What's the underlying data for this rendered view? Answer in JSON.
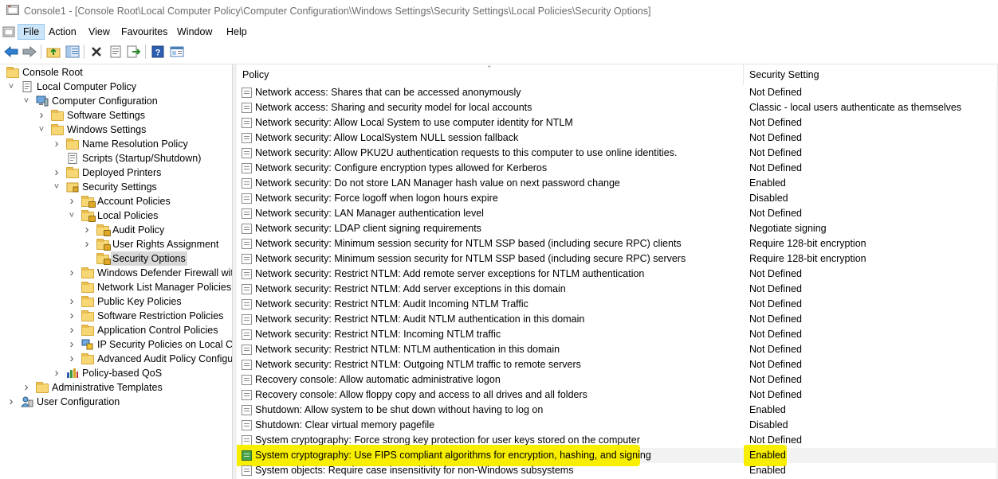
{
  "window": {
    "title": "Console1 - [Console Root\\Local Computer Policy\\Computer Configuration\\Windows Settings\\Security Settings\\Local Policies\\Security Options]"
  },
  "menu": {
    "items": [
      "File",
      "Action",
      "View",
      "Favourites",
      "Window",
      "Help"
    ],
    "active": "File"
  },
  "toolbar": {
    "buttons": [
      "back-icon",
      "forward-icon",
      "up-folder-icon",
      "show-hide-tree-icon",
      "delete-icon",
      "properties-icon",
      "export-list-icon",
      "help-icon",
      "extended-view-icon"
    ]
  },
  "tree": {
    "items": [
      {
        "label": "Console Root",
        "selected": false
      },
      {
        "label": "Local Computer Policy",
        "selected": false
      },
      {
        "label": "Computer Configuration",
        "selected": false
      },
      {
        "label": "Software Settings",
        "selected": false
      },
      {
        "label": "Windows Settings",
        "selected": false
      },
      {
        "label": "Name Resolution Policy",
        "selected": false
      },
      {
        "label": "Scripts (Startup/Shutdown)",
        "selected": false
      },
      {
        "label": "Deployed Printers",
        "selected": false
      },
      {
        "label": "Security Settings",
        "selected": false
      },
      {
        "label": "Account Policies",
        "selected": false
      },
      {
        "label": "Local Policies",
        "selected": false
      },
      {
        "label": "Audit Policy",
        "selected": false
      },
      {
        "label": "User Rights Assignment",
        "selected": false
      },
      {
        "label": "Security Options",
        "selected": true
      },
      {
        "label": "Windows Defender Firewall with",
        "selected": false
      },
      {
        "label": "Network List Manager Policies",
        "selected": false
      },
      {
        "label": "Public Key Policies",
        "selected": false
      },
      {
        "label": "Software Restriction Policies",
        "selected": false
      },
      {
        "label": "Application Control Policies",
        "selected": false
      },
      {
        "label": "IP Security Policies on Local Cor",
        "selected": false
      },
      {
        "label": "Advanced Audit Policy Configur",
        "selected": false
      },
      {
        "label": "Policy-based QoS",
        "selected": false
      },
      {
        "label": "Administrative Templates",
        "selected": false
      },
      {
        "label": "User Configuration",
        "selected": false
      }
    ]
  },
  "list": {
    "columns": {
      "policy": "Policy",
      "setting": "Security Setting"
    },
    "rows": [
      {
        "policy": "Network access: Shares that can be accessed anonymously",
        "setting": "Not Defined"
      },
      {
        "policy": "Network access: Sharing and security model for local accounts",
        "setting": "Classic - local users authenticate as themselves"
      },
      {
        "policy": "Network security: Allow Local System to use computer identity for NTLM",
        "setting": "Not Defined"
      },
      {
        "policy": "Network security: Allow LocalSystem NULL session fallback",
        "setting": "Not Defined"
      },
      {
        "policy": "Network security: Allow PKU2U authentication requests to this computer to use online identities.",
        "setting": "Not Defined"
      },
      {
        "policy": "Network security: Configure encryption types allowed for Kerberos",
        "setting": "Not Defined"
      },
      {
        "policy": "Network security: Do not store LAN Manager hash value on next password change",
        "setting": "Enabled"
      },
      {
        "policy": "Network security: Force logoff when logon hours expire",
        "setting": "Disabled"
      },
      {
        "policy": "Network security: LAN Manager authentication level",
        "setting": "Not Defined"
      },
      {
        "policy": "Network security: LDAP client signing requirements",
        "setting": "Negotiate signing"
      },
      {
        "policy": "Network security: Minimum session security for NTLM SSP based (including secure RPC) clients",
        "setting": "Require 128-bit encryption"
      },
      {
        "policy": "Network security: Minimum session security for NTLM SSP based (including secure RPC) servers",
        "setting": "Require 128-bit encryption"
      },
      {
        "policy": "Network security: Restrict NTLM: Add remote server exceptions for NTLM authentication",
        "setting": "Not Defined"
      },
      {
        "policy": "Network security: Restrict NTLM: Add server exceptions in this domain",
        "setting": "Not Defined"
      },
      {
        "policy": "Network security: Restrict NTLM: Audit Incoming NTLM Traffic",
        "setting": "Not Defined"
      },
      {
        "policy": "Network security: Restrict NTLM: Audit NTLM authentication in this domain",
        "setting": "Not Defined"
      },
      {
        "policy": "Network security: Restrict NTLM: Incoming NTLM traffic",
        "setting": "Not Defined"
      },
      {
        "policy": "Network security: Restrict NTLM: NTLM authentication in this domain",
        "setting": "Not Defined"
      },
      {
        "policy": "Network security: Restrict NTLM: Outgoing NTLM traffic to remote servers",
        "setting": "Not Defined"
      },
      {
        "policy": "Recovery console: Allow automatic administrative logon",
        "setting": "Not Defined"
      },
      {
        "policy": "Recovery console: Allow floppy copy and access to all drives and all folders",
        "setting": "Not Defined"
      },
      {
        "policy": "Shutdown: Allow system to be shut down without having to log on",
        "setting": "Enabled"
      },
      {
        "policy": "Shutdown: Clear virtual memory pagefile",
        "setting": "Disabled"
      },
      {
        "policy": "System cryptography: Force strong key protection for user keys stored on the computer",
        "setting": "Not Defined"
      },
      {
        "policy": "System cryptography: Use FIPS compliant algorithms for encryption, hashing, and signing",
        "setting": "Enabled",
        "highlighted": true
      },
      {
        "policy": "System objects: Require case insensitivity for non-Windows subsystems",
        "setting": "Enabled"
      }
    ]
  },
  "colors": {
    "highlight": "#f8ee00",
    "selection": "#d9d9d9"
  }
}
